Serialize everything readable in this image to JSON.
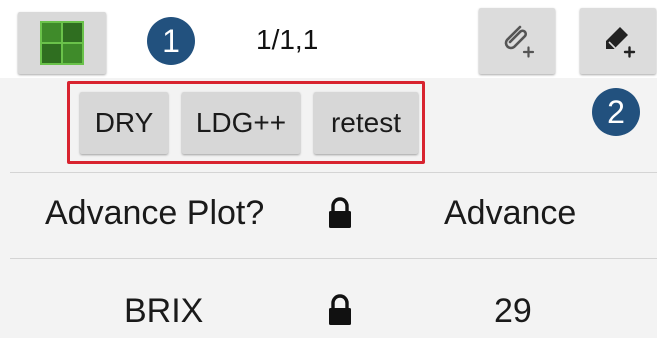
{
  "toolbar": {
    "grid_icon": "grid-icon",
    "badge_1": "1",
    "page_counter": "1/1,1",
    "attach_icon": "paperclip-plus-icon",
    "note_icon": "pencil-plus-icon"
  },
  "quick_buttons": {
    "items": [
      {
        "label": "DRY"
      },
      {
        "label": "LDG++"
      },
      {
        "label": "retest"
      }
    ],
    "highlight_color": "#d8232f"
  },
  "badge_2": "2",
  "rows": [
    {
      "label": "Advance Plot?",
      "lock_icon": "lock-icon",
      "value": "Advance"
    },
    {
      "label": "BRIX",
      "lock_icon": "lock-icon",
      "value": "29"
    }
  ],
  "colors": {
    "badge": "#22517e",
    "grid_green": "#3f8b2a"
  }
}
